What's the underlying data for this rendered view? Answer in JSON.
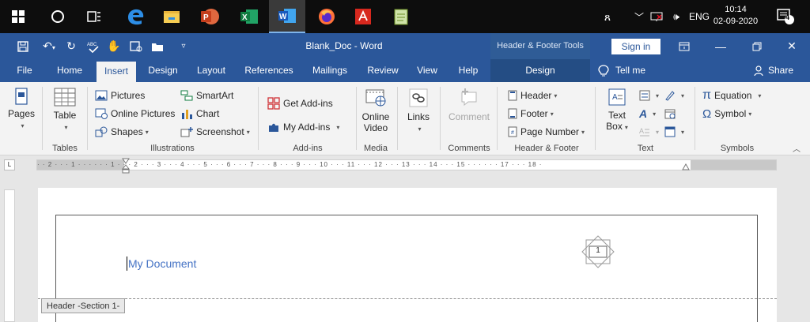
{
  "taskbar": {
    "time": "10:14",
    "date": "02-09-2020",
    "language": "ENG",
    "notification_count": "4",
    "people_icon": "person-a-icon"
  },
  "titlebar": {
    "document_title": "Blank_Doc  -  Word",
    "contextual_tools": "Header & Footer Tools",
    "sign_in": "Sign in"
  },
  "tabs": [
    {
      "label": "File"
    },
    {
      "label": "Home"
    },
    {
      "label": "Insert"
    },
    {
      "label": "Design"
    },
    {
      "label": "Layout"
    },
    {
      "label": "References"
    },
    {
      "label": "Mailings"
    },
    {
      "label": "Review"
    },
    {
      "label": "View"
    },
    {
      "label": "Help"
    },
    {
      "label": "Design"
    }
  ],
  "tell_me": "Tell me",
  "share": "Share",
  "ribbon": {
    "pages": {
      "label": "Pages"
    },
    "tables": {
      "table": "Table",
      "group": "Tables"
    },
    "illustrations": {
      "pictures": "Pictures",
      "online_pictures": "Online Pictures",
      "shapes": "Shapes",
      "smartart": "SmartArt",
      "chart": "Chart",
      "screenshot": "Screenshot",
      "group": "Illustrations"
    },
    "addins": {
      "get": "Get Add-ins",
      "my": "My Add-ins",
      "group": "Add-ins"
    },
    "media": {
      "online_video_1": "Online",
      "online_video_2": "Video",
      "group": "Media"
    },
    "links": {
      "label": "Links"
    },
    "comments": {
      "label": "Comment",
      "group": "Comments"
    },
    "header_footer": {
      "header": "Header",
      "footer": "Footer",
      "page_number": "Page Number",
      "group": "Header & Footer"
    },
    "text": {
      "text_box_1": "Text",
      "text_box_2": "Box",
      "group": "Text"
    },
    "symbols": {
      "equation": "Equation",
      "symbol": "Symbol",
      "group": "Symbols"
    }
  },
  "ruler": {
    "corner": "L",
    "marks": "· · 2 · · · 1 · · ·   · · · 1 · · · 2 · · · 3 · · · 4 · · · 5 · · · 6 · · · 7 · · · 8 · · · 9 · · · 10 · · · 11 · · · 12 · · · 13 · · · 14 · · · 15 · · ·   · · · 17 · · · 18 ·"
  },
  "document": {
    "header_text": "My Document",
    "header_label": "Header -Section 1-",
    "page_number": "1"
  }
}
